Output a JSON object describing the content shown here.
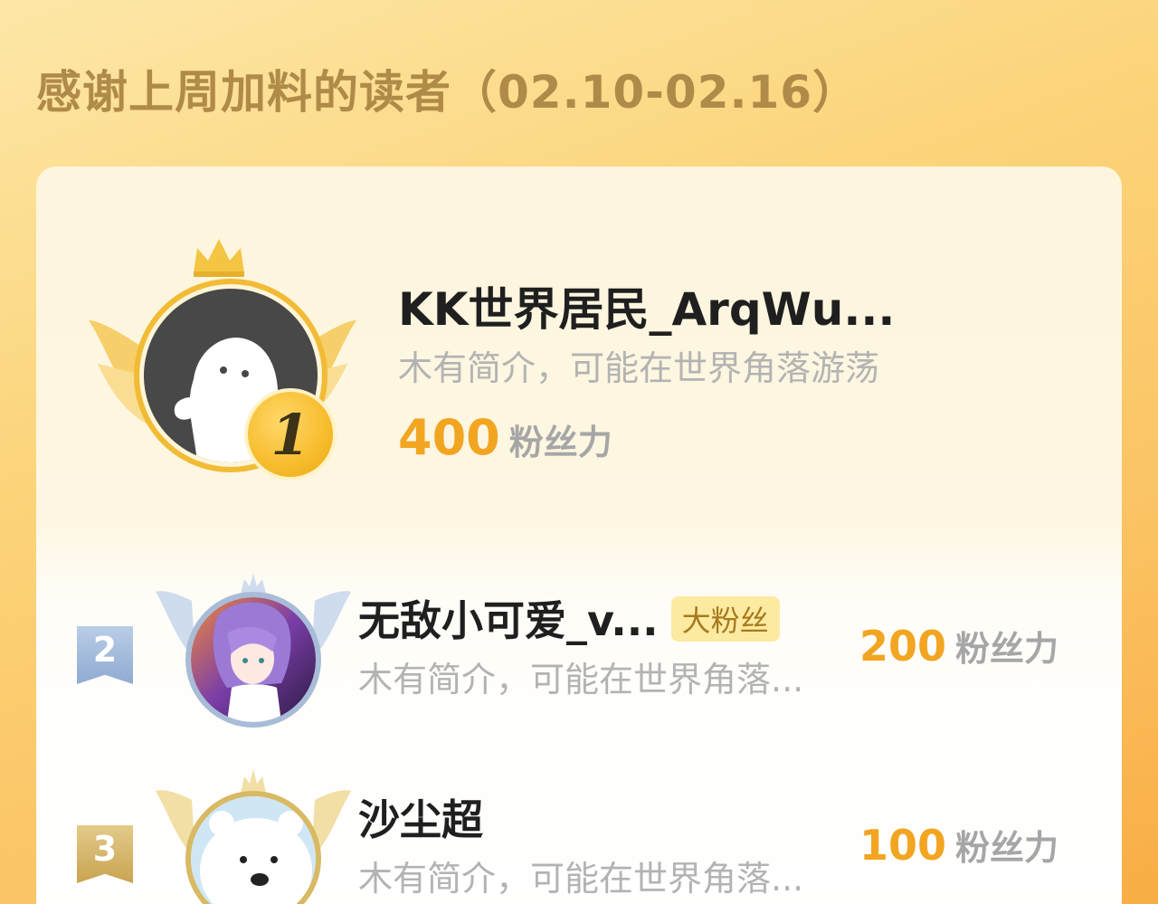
{
  "header": {
    "title": "感谢上周加料的读者（02.10-02.16）"
  },
  "unit_label": "粉丝力",
  "top_reader": {
    "rank": "1",
    "name": "KK世界居民_ArqWu...",
    "bio": "木有简介，可能在世界角落游荡",
    "score": "400",
    "avatar": "ghost-default-avatar",
    "medal_color": "#f7bc2c"
  },
  "readers": [
    {
      "rank": "2",
      "name": "无敌小可爱_v...",
      "badge": "大粉丝",
      "bio": "木有简介，可能在世界角落...",
      "score": "200",
      "avatar": "anime-girl-avatar",
      "rank_color": "#a8bcd8"
    },
    {
      "rank": "3",
      "name": "沙尘超",
      "bio": "木有简介，可能在世界角落...",
      "score": "100",
      "avatar": "polar-bear-avatar",
      "rank_color": "#d8b964"
    }
  ],
  "colors": {
    "accent": "#f2a521",
    "title": "#b08a48",
    "muted": "#b3b3b3"
  }
}
